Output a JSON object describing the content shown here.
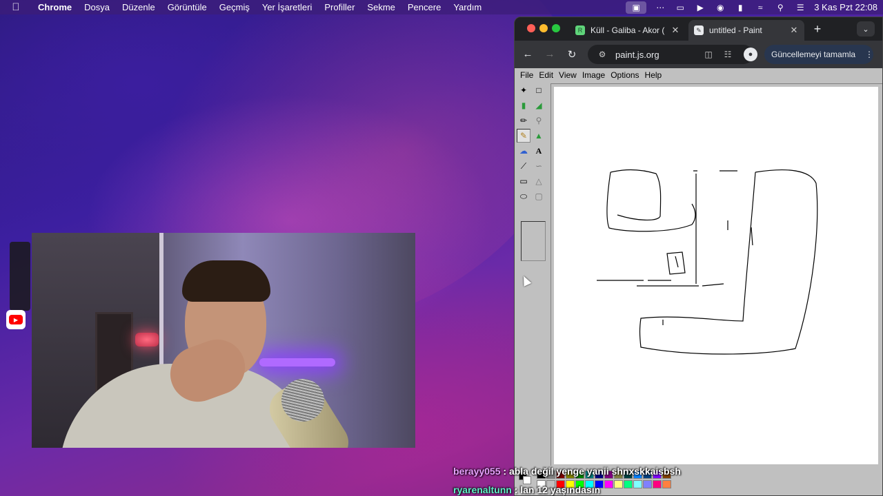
{
  "menubar": {
    "apple_icon": "apple-icon",
    "app_name": "Chrome",
    "items": [
      "Dosya",
      "Düzenle",
      "Görüntüle",
      "Geçmiş",
      "Yer İşaretleri",
      "Profiller",
      "Sekme",
      "Pencere",
      "Yardım"
    ],
    "clock": "3 Kas Pzt  22:08"
  },
  "browser": {
    "tabs": [
      {
        "title": "Küll - Galiba - Akor (G",
        "favicon": "R"
      },
      {
        "title": "untitled - Paint",
        "favicon": "paint"
      }
    ],
    "new_tab": "+",
    "url": "paint.js.org",
    "update_label": "Güncellemeyi tamamla"
  },
  "paint": {
    "menu": [
      "File",
      "Edit",
      "View",
      "Image",
      "Options",
      "Help"
    ]
  },
  "chat": [
    {
      "user": "berayy055",
      "message": ": abla değil yenge yanii shnxskkaisbsh"
    },
    {
      "user": "ryarenaltunn",
      "message": ": lan 12 yaşındasın"
    }
  ],
  "colors": {
    "palette": [
      "#000000",
      "#808080",
      "#800000",
      "#808000",
      "#008000",
      "#008080",
      "#000080",
      "#800080",
      "#808040",
      "#004040",
      "#0080ff",
      "#004080",
      "#8000ff",
      "#804000",
      "#ffffff",
      "#c0c0c0",
      "#ff0000",
      "#ffff00",
      "#00ff00",
      "#00ffff",
      "#0000ff",
      "#ff00ff",
      "#ffff80",
      "#00ff80",
      "#80ffff",
      "#8080ff",
      "#ff0080",
      "#ff8040"
    ]
  }
}
